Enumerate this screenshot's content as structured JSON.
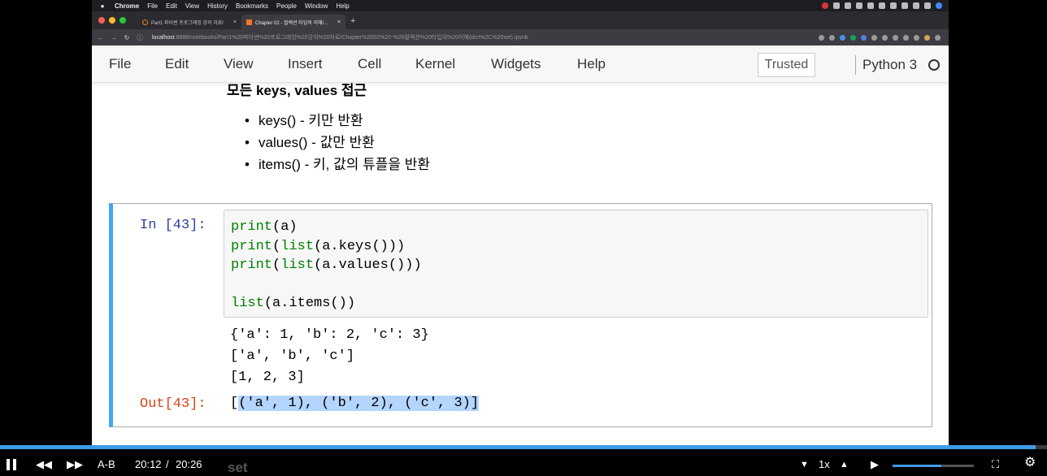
{
  "mac_menubar": {
    "app": "Chrome",
    "items": [
      "File",
      "Edit",
      "View",
      "History",
      "Bookmarks",
      "People",
      "Window",
      "Help"
    ]
  },
  "browser": {
    "tabs": [
      {
        "title": "Part1 파이썬 프로그래밍 강의 자료/",
        "active": false
      },
      {
        "title": "Chapter 02 - 컬렉션 타입의 이해/...",
        "active": true
      }
    ],
    "address": {
      "host": "localhost",
      "rest": ":8888/notebooks/Part1%20파이썬%20프로그래밍%20강의%20자료/Chapter%2002%20-%20컬렉션%20타입의%20이해(dict%2C%20set).ipynb"
    }
  },
  "jupyter": {
    "menu": [
      "File",
      "Edit",
      "View",
      "Insert",
      "Cell",
      "Kernel",
      "Widgets",
      "Help"
    ],
    "trusted": "Trusted",
    "kernel": "Python 3"
  },
  "markdown": {
    "heading": "모든 keys, values 접근",
    "bullets": [
      "keys() - 키만 반환",
      "values() - 값만 반환",
      "items() - 키, 값의 튜플을 반환"
    ]
  },
  "cell": {
    "in_prompt": "In [43]:",
    "out_prompt": "Out[43]:",
    "code": [
      [
        {
          "t": "print",
          "kw": true
        },
        {
          "t": "(a)",
          "kw": false
        }
      ],
      [
        {
          "t": "print",
          "kw": true
        },
        {
          "t": "(",
          "kw": false
        },
        {
          "t": "list",
          "kw": true
        },
        {
          "t": "(a.keys()))",
          "kw": false
        }
      ],
      [
        {
          "t": "print",
          "kw": true
        },
        {
          "t": "(",
          "kw": false
        },
        {
          "t": "list",
          "kw": true
        },
        {
          "t": "(a.values()))",
          "kw": false
        }
      ],
      [],
      [
        {
          "t": "list",
          "kw": true
        },
        {
          "t": "(a.items())",
          "kw": false
        }
      ]
    ],
    "stdout": [
      "{'a': 1, 'b': 2, 'c': 3}",
      "['a', 'b', 'c']",
      "[1, 2, 3]"
    ],
    "output_prefix": "[",
    "output_selected": "('a', 1), ('b', 2), ('c', 3)]"
  },
  "player": {
    "ab_label": "A-B",
    "current_time": "20:12",
    "separator": "/",
    "total_time": "20:26",
    "speed": "1x",
    "progress": 0.989,
    "volume": 0.6,
    "next_heading_peek": "set"
  }
}
